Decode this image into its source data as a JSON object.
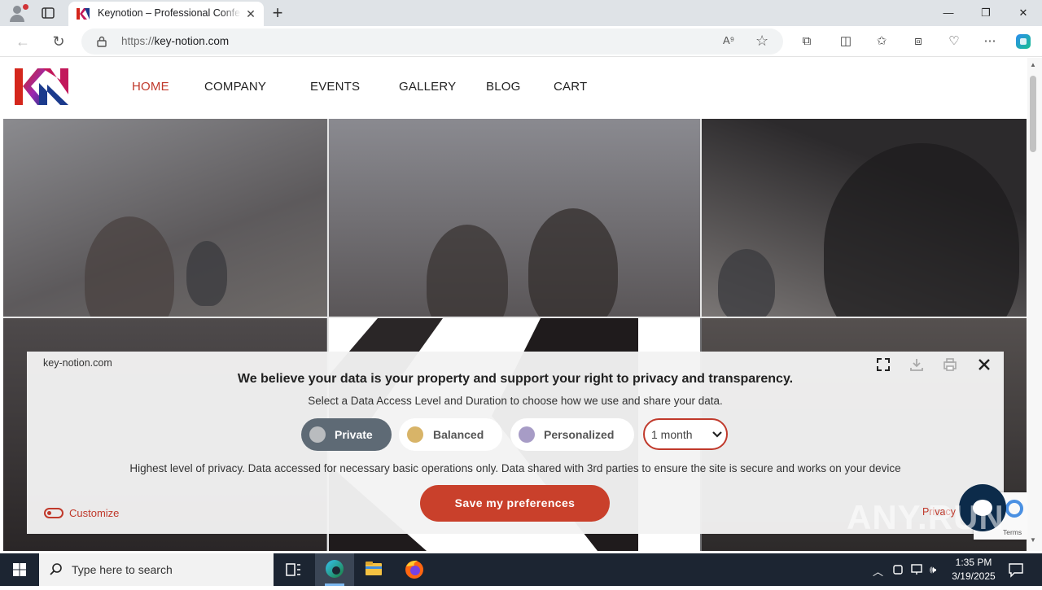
{
  "browser": {
    "tab_title": "Keynotion – Professional Conferences",
    "tab_close": "✕",
    "new_tab": "+",
    "url_scheme": "https://",
    "url_host": "key-notion.com",
    "read_aloud": "A⁹",
    "window_controls": {
      "minimize": "—",
      "restore": "❐",
      "close": "✕"
    }
  },
  "site": {
    "menu": [
      "HOME",
      "COMPANY",
      "EVENTS",
      "GALLERY",
      "BLOG",
      "CART"
    ],
    "active_menu": "HOME",
    "logo_colors": [
      "#d4261c",
      "#8a2be2",
      "#1b3a8c"
    ]
  },
  "cookie_banner": {
    "site": "key-notion.com",
    "title": "We believe your data is your property and support your right to privacy and transparency.",
    "subtitle": "Select a Data Access Level and Duration to choose how we use and share your data.",
    "levels": [
      {
        "label": "Private",
        "color": "#b9bcbf",
        "selected": true
      },
      {
        "label": "Balanced",
        "color": "#d8b468",
        "selected": false
      },
      {
        "label": "Personalized",
        "color": "#a79cc6",
        "selected": false
      }
    ],
    "duration": "1 month",
    "description": "Highest level of privacy. Data accessed for necessary basic operations only. Data shared with 3rd parties to ensure the site is secure and works on your device",
    "save_button": "Save my preferences",
    "customize": "Customize",
    "privacy": "Privacy",
    "accent_color": "#c9402b"
  },
  "recaptcha": {
    "terms": "Terms"
  },
  "watermark": "ANY.RUN",
  "taskbar": {
    "search_placeholder": "Type here to search",
    "time": "1:35 PM",
    "date": "3/19/2025"
  }
}
